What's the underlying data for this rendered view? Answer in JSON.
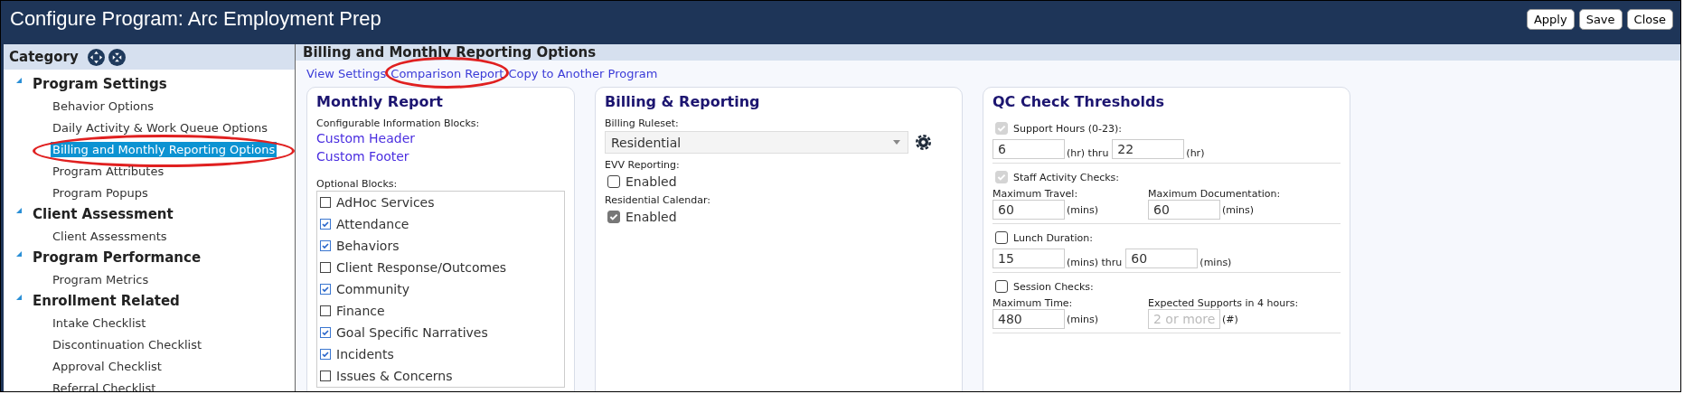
{
  "window": {
    "title": "Configure Program: Arc Employment Prep",
    "buttons": [
      "Apply",
      "Save",
      "Close"
    ]
  },
  "sidebar": {
    "title": "Category",
    "groups": [
      {
        "label": "Program Settings",
        "expanded": true,
        "children": [
          {
            "label": "Behavior Options",
            "selected": false,
            "annotated": false
          },
          {
            "label": "Daily Activity & Work Queue Options",
            "selected": false,
            "annotated": false
          },
          {
            "label": "Billing and Monthly Reporting Options",
            "selected": true,
            "annotated": true
          },
          {
            "label": "Program Attributes",
            "selected": false,
            "annotated": false
          },
          {
            "label": "Program Popups",
            "selected": false,
            "annotated": false
          }
        ]
      },
      {
        "label": "Client Assessment",
        "expanded": true,
        "children": [
          {
            "label": "Client Assessments",
            "selected": false,
            "annotated": false
          }
        ]
      },
      {
        "label": "Program Performance",
        "expanded": true,
        "children": [
          {
            "label": "Program Metrics",
            "selected": false,
            "annotated": false
          }
        ]
      },
      {
        "label": "Enrollment Related",
        "expanded": true,
        "children": [
          {
            "label": "Intake Checklist",
            "selected": false,
            "annotated": false
          },
          {
            "label": "Discontinuation Checklist",
            "selected": false,
            "annotated": false
          },
          {
            "label": "Approval Checklist",
            "selected": false,
            "annotated": false
          },
          {
            "label": "Referral Checklist",
            "selected": false,
            "annotated": false
          }
        ]
      }
    ]
  },
  "panel": {
    "title": "Billing and Monthly Reporting Options",
    "links": [
      {
        "label": "View Settings",
        "annotated": false
      },
      {
        "label": "Comparison Report",
        "annotated": true
      },
      {
        "label": "Copy to Another Program",
        "annotated": false
      }
    ],
    "monthly_report": {
      "title": "Monthly Report",
      "info_label": "Configurable Information Blocks:",
      "info_links": [
        "Custom Header",
        "Custom Footer"
      ],
      "optional_label": "Optional Blocks:",
      "blocks": [
        {
          "label": "AdHoc Services",
          "checked": false
        },
        {
          "label": "Attendance",
          "checked": true
        },
        {
          "label": "Behaviors",
          "checked": true
        },
        {
          "label": "Client Response/Outcomes",
          "checked": false
        },
        {
          "label": "Community",
          "checked": true
        },
        {
          "label": "Finance",
          "checked": false
        },
        {
          "label": "Goal Specific Narratives",
          "checked": true
        },
        {
          "label": "Incidents",
          "checked": true
        },
        {
          "label": "Issues & Concerns",
          "checked": false
        }
      ]
    },
    "billing": {
      "title": "Billing & Reporting",
      "ruleset_label": "Billing Ruleset:",
      "ruleset_value": "Residential",
      "options": [
        {
          "label": "EVV Reporting:",
          "checkbox_label": "Enabled",
          "checked": false,
          "disabled": false
        },
        {
          "label": "Residential Calendar:",
          "checkbox_label": "Enabled",
          "checked": true,
          "disabled": true
        }
      ]
    },
    "qc": {
      "title": "QC Check Thresholds",
      "sections": [
        {
          "label": "Support Hours (0-23):",
          "checked": true,
          "disabled": true,
          "kind": "inline",
          "fields": [
            {
              "value": "6",
              "unit": "(hr) thru"
            },
            {
              "value": "22",
              "unit": "(hr)"
            }
          ]
        },
        {
          "label": "Staff Activity Checks:",
          "checked": true,
          "disabled": true,
          "kind": "labeled",
          "fields": [
            {
              "label": "Maximum Travel:",
              "value": "60",
              "unit": "(mins)"
            },
            {
              "label": "Maximum Documentation:",
              "value": "60",
              "unit": "(mins)"
            }
          ]
        },
        {
          "label": "Lunch Duration:",
          "checked": false,
          "disabled": false,
          "kind": "inline",
          "fields": [
            {
              "value": "15",
              "unit": "(mins) thru"
            },
            {
              "value": "60",
              "unit": "(mins)"
            }
          ]
        },
        {
          "label": "Session Checks:",
          "checked": false,
          "disabled": false,
          "kind": "labeled",
          "fields": [
            {
              "label": "Maximum Time:",
              "value": "480",
              "unit": "(mins)"
            },
            {
              "label": "Expected Supports in 4 hours:",
              "placeholder": "2 or more",
              "unit": "(#)"
            }
          ]
        }
      ]
    }
  }
}
